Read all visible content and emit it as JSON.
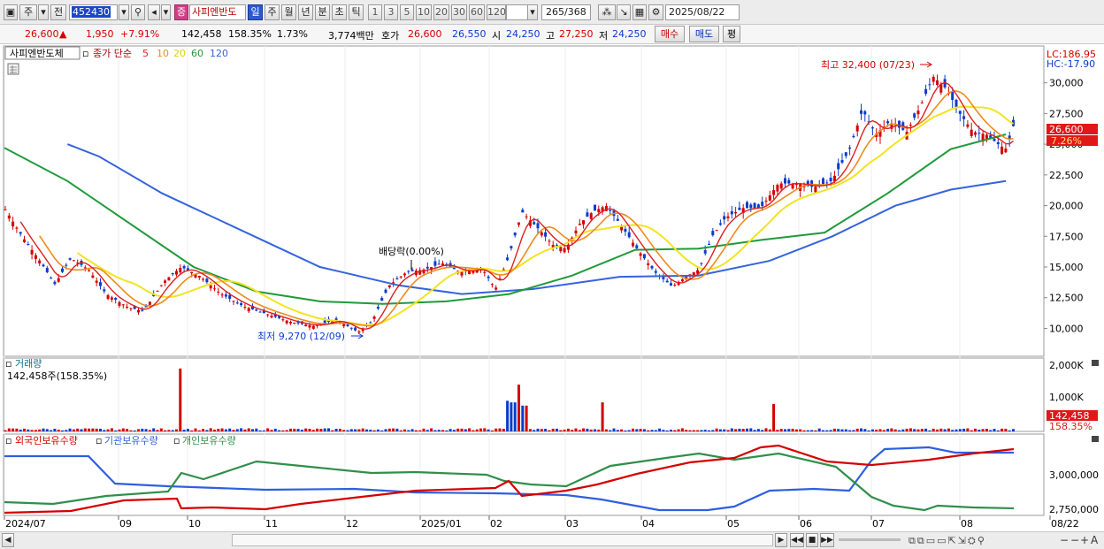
{
  "toolbar": {
    "market": "주",
    "prev": "전",
    "code": "452430",
    "name": "사피엔반도",
    "periods": [
      "일",
      "주",
      "월",
      "년",
      "분",
      "초",
      "틱"
    ],
    "active_period": "일",
    "intervals": [
      "1",
      "3",
      "5",
      "10",
      "20",
      "30",
      "60",
      "120"
    ],
    "count": "265",
    "count_total": "/368",
    "date": "2025/08/22"
  },
  "quote": {
    "price": "26,600",
    "change": "1,950",
    "change_pct": "+7.91%",
    "volume": "142,458",
    "vol_ratio": "158.35%",
    "turnover": "1.73%",
    "amount": "3,774백만",
    "ask_label": "호가",
    "ask1": "26,600",
    "ask2": "26,550",
    "open_label": "시",
    "open": "24,250",
    "high_label": "고",
    "high": "27,250",
    "low_label": "저",
    "low": "24,250",
    "buy_label": "매수",
    "sell_label": "매도",
    "avg_label": "평"
  },
  "price_panel": {
    "stock_label": "사피엔반도체",
    "ma_title": "종가 단순",
    "ma_periods": [
      "5",
      "10",
      "20",
      "60",
      "120"
    ],
    "lc": "LC:186.95",
    "hc": "HC:-17.90",
    "high_note": "최고 32,400 (07/23)",
    "low_note": "최저 9,270 (12/09)",
    "dividend_note": "배당락(0.00%)",
    "current_price": "26,600",
    "current_pct": "7.26%"
  },
  "volume_panel": {
    "title": "거래량",
    "current": "142,458주(158.35%)",
    "axis": [
      "2,000K",
      "1,000K"
    ],
    "tag_value": "142,458",
    "tag_pct": "158.35%"
  },
  "holding_panel": {
    "legend": [
      "외국인보유수량",
      "기관보유수량",
      "개인보유수량"
    ],
    "axis": [
      "3,000,000",
      "2,750,000"
    ]
  },
  "date_axis": [
    "2024/07",
    "09",
    "10",
    "11",
    "12",
    "2025/01",
    "02",
    "03",
    "04",
    "05",
    "06",
    "07",
    "08",
    "08/22"
  ],
  "colors": {
    "up": "#d40000",
    "down": "#0a3cc8",
    "ma5": "#dd1f1f",
    "ma10": "#f08a1a",
    "ma20": "#f2e420",
    "ma60": "#1f9a3a",
    "ma120": "#3463dc",
    "foreign": "#d40000",
    "inst": "#2f5fe0",
    "retail": "#2f8f4a"
  },
  "chart_data": {
    "type": "line",
    "title": "사피엔반도체",
    "price_axis_ticks": [
      30000,
      27500,
      25000,
      22500,
      20000,
      17500,
      15000,
      12500,
      10000
    ],
    "price_range": [
      7800,
      33000
    ],
    "ma120": [
      [
        2024.58,
        25000
      ],
      [
        2024.62,
        24000
      ],
      [
        2024.7,
        21000
      ],
      [
        2024.8,
        18000
      ],
      [
        2024.9,
        15000
      ],
      [
        2025.0,
        13500
      ],
      [
        2025.08,
        12800
      ],
      [
        2025.17,
        13200
      ],
      [
        2025.28,
        14200
      ],
      [
        2025.38,
        14300
      ],
      [
        2025.47,
        15500
      ],
      [
        2025.55,
        17500
      ],
      [
        2025.63,
        20000
      ],
      [
        2025.7,
        21300
      ],
      [
        2025.77,
        22000
      ]
    ],
    "ma60": [
      [
        2024.5,
        24700
      ],
      [
        2024.58,
        22000
      ],
      [
        2024.66,
        18500
      ],
      [
        2024.74,
        15000
      ],
      [
        2024.82,
        13000
      ],
      [
        2024.9,
        12200
      ],
      [
        2024.98,
        12000
      ],
      [
        2025.06,
        12200
      ],
      [
        2025.14,
        12800
      ],
      [
        2025.22,
        14300
      ],
      [
        2025.3,
        16400
      ],
      [
        2025.38,
        16500
      ],
      [
        2025.46,
        17200
      ],
      [
        2025.54,
        17800
      ],
      [
        2025.62,
        21000
      ],
      [
        2025.7,
        24600
      ],
      [
        2025.77,
        25800
      ]
    ],
    "note": "price series simplified; axis ticks and labels are copied from the screenshot"
  }
}
